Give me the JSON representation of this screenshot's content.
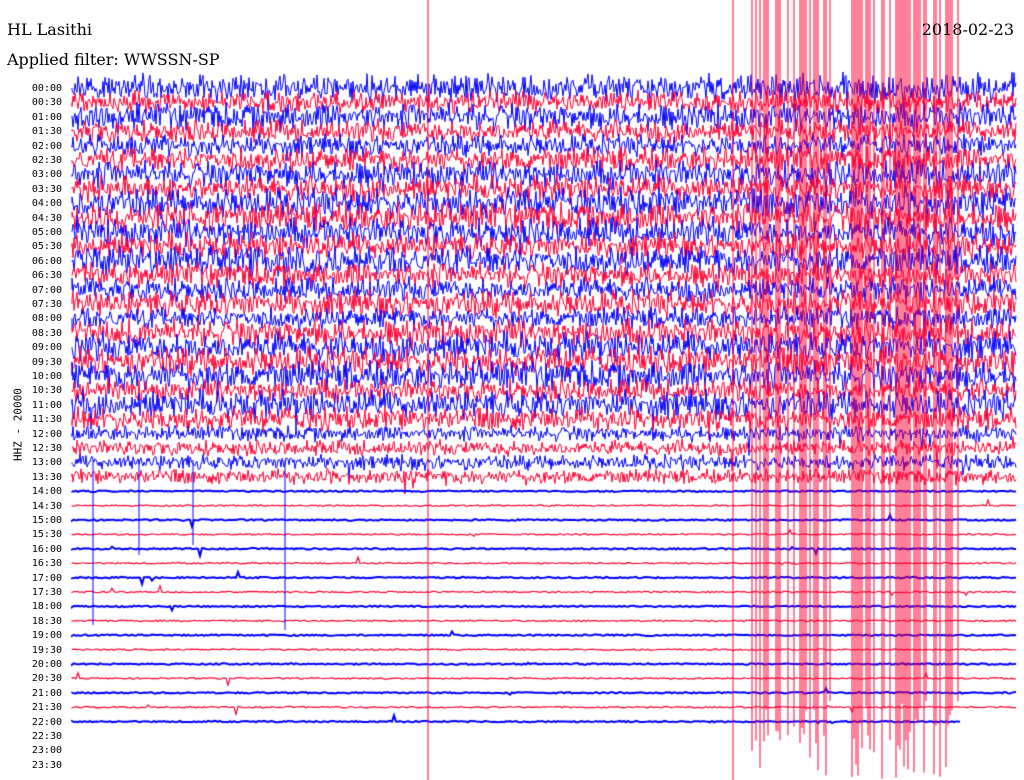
{
  "header": {
    "station": "HL Lasithi",
    "filter": "Applied filter: WWSSN-SP",
    "date": "2018-02-23"
  },
  "channel_label": "HHZ - 20000",
  "colors": {
    "blue_trace": "#0000ff",
    "red_trace": "#ff0033",
    "background": "#ffffff"
  },
  "chart_data": {
    "type": "line",
    "title": "HL Lasithi",
    "subtitle": "Applied filter: WWSSN-SP",
    "ylabel": "HHZ - 20000",
    "row_labels": [
      "00:00",
      "00:30",
      "01:00",
      "01:30",
      "02:00",
      "02:30",
      "03:00",
      "03:30",
      "04:00",
      "04:30",
      "05:00",
      "05:30",
      "06:00",
      "06:30",
      "07:00",
      "07:30",
      "08:00",
      "08:30",
      "09:00",
      "09:30",
      "10:00",
      "10:30",
      "11:00",
      "11:30",
      "12:00",
      "12:30",
      "13:00",
      "13:30",
      "14:00",
      "14:30",
      "15:00",
      "15:30",
      "16:00",
      "16:30",
      "17:00",
      "17:30",
      "18:00",
      "18:30",
      "19:00",
      "19:30",
      "20:00",
      "20:30",
      "21:00",
      "21:30",
      "22:00",
      "22:30",
      "23:00",
      "23:30"
    ],
    "series": [
      {
        "color": "blue",
        "rows": "even"
      },
      {
        "color": "red",
        "rows": "odd"
      }
    ],
    "noisy_rows_through": "13:30",
    "recording_ends_at": "22:00"
  }
}
